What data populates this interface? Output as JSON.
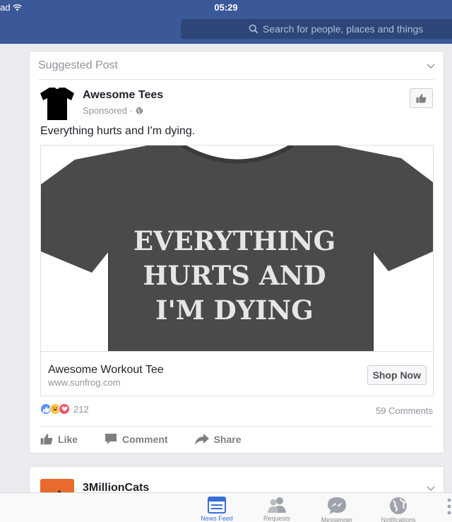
{
  "status_bar": {
    "carrier": "ad",
    "time": "05:29",
    "wifi_icon": "wifi-icon"
  },
  "search": {
    "placeholder": "Search for people, places and things",
    "icon": "search-icon"
  },
  "suggested_post": {
    "header": "Suggested Post",
    "page_name": "Awesome Tees",
    "sponsored": "Sponsored ·",
    "post_text": "Everything hurts and I'm dying.",
    "shirt_text": [
      "EVERYTHING",
      "HURTS AND",
      "I'M DYING"
    ],
    "link_title": "Awesome Workout Tee",
    "link_domain": "www.sunfrog.com",
    "cta": "Shop Now",
    "reaction_count": "212",
    "comments": "59 Comments",
    "actions": {
      "like": "Like",
      "comment": "Comment",
      "share": "Share"
    }
  },
  "next_post": {
    "page_name": "3MillionCats"
  },
  "tabs": [
    {
      "label": "News Feed",
      "icon": "news-feed-icon",
      "active": true
    },
    {
      "label": "Requests",
      "icon": "requests-icon",
      "active": false
    },
    {
      "label": "Messenger",
      "icon": "messenger-icon",
      "active": false
    },
    {
      "label": "Notifications",
      "icon": "globe-icon",
      "active": false
    }
  ],
  "colors": {
    "brand_blue": "#3b5998",
    "active_tab": "#3b6fd8",
    "shirt_gray": "#4a4a4a"
  }
}
